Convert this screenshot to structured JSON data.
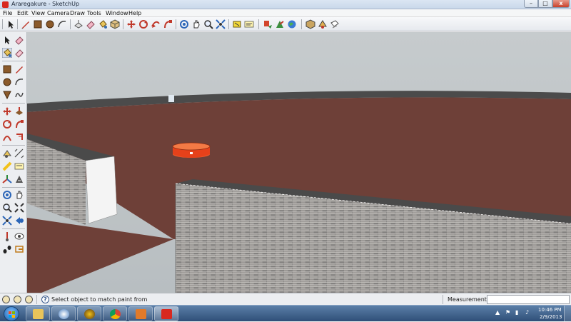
{
  "window": {
    "title": "Araregakure - SketchUp",
    "minimize_glyph": "–",
    "maximize_glyph": "□",
    "close_glyph": "x"
  },
  "menu": {
    "items": [
      "File",
      "Edit",
      "View",
      "Camera",
      "Draw",
      "Tools",
      "Window",
      "Help"
    ]
  },
  "toolbar": {
    "icons": [
      "select-icon",
      "pencil-icon",
      "rectangle-icon",
      "circle-icon",
      "arc-icon",
      "push-pull-icon",
      "eraser-icon",
      "paint-bucket-icon",
      "make-component-icon",
      "move-icon",
      "rotate-icon",
      "follow-me-icon",
      "orbit-icon",
      "pan-icon",
      "zoom-icon",
      "zoom-extents-icon",
      "tape-measure-icon",
      "text-icon",
      "get-models-icon",
      "share-model-icon",
      "google-earth-icon",
      "components-icon",
      "materials-icon",
      "styles-icon"
    ]
  },
  "left_toolbar": {
    "icons": [
      "select-icon",
      "eraser-icon",
      "paint-bucket-icon",
      "eraser-alt-icon",
      "rectangle-icon",
      "line-icon",
      "circle-icon",
      "arc-icon",
      "polygon-icon",
      "freehand-icon",
      "move-icon",
      "push-pull-icon",
      "rotate-icon",
      "follow-me-icon",
      "scale-icon",
      "offset-icon",
      "tape-measure-icon",
      "dimension-icon",
      "protractor-icon",
      "text-icon",
      "axes-icon",
      "3d-text-icon",
      "orbit-icon",
      "pan-icon",
      "zoom-icon",
      "zoom-window-icon",
      "zoom-extents-icon",
      "previous-view-icon",
      "position-camera-icon",
      "look-around-icon",
      "walk-icon",
      "section-plane-icon"
    ]
  },
  "status": {
    "message": "Select object to match paint from",
    "help_glyph": "?",
    "measurements_label": "Measurements",
    "measurements_value": ""
  },
  "taskbar": {
    "time": "10:46 PM",
    "date": "2/9/2013",
    "apps": [
      "file-explorer-icon",
      "media-player-icon",
      "warcraft-icon",
      "chrome-icon",
      "media-center-icon",
      "sketchup-icon"
    ]
  },
  "colors": {
    "ground": "#6e4038",
    "brick": "#8c8a88",
    "wall_top": "#4a4a4a",
    "cylinder": "#e6411a",
    "sky": "#bfc5c8"
  }
}
